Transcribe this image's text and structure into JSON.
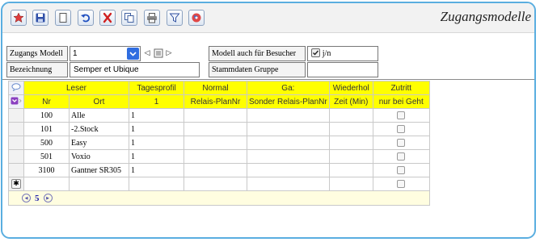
{
  "title": "Zugangsmodelle",
  "toolbar": {
    "buttons": [
      {
        "name": "home-button",
        "icon": "star-icon"
      },
      {
        "name": "save-button",
        "icon": "floppy-disk-icon"
      },
      {
        "name": "new-button",
        "icon": "document-icon"
      },
      {
        "name": "undo-button",
        "icon": "undo-icon"
      },
      {
        "name": "delete-button",
        "icon": "delete-x-icon"
      },
      {
        "name": "copy-button",
        "icon": "copy-icon"
      },
      {
        "name": "print-button",
        "icon": "printer-icon"
      },
      {
        "name": "filter-button",
        "icon": "funnel-icon"
      },
      {
        "name": "help-button",
        "icon": "help-icon"
      }
    ]
  },
  "form": {
    "zugangs_modell_label": "Zugangs Modell",
    "zugangs_modell_value": "1",
    "bezeichnung_label": "Bezeichnung",
    "bezeichnung_value": "Semper et Ubique",
    "modell_besucher_label": "Modell auch für Besucher",
    "modell_besucher_checked": true,
    "modell_besucher_option": "j/n",
    "stammdaten_label": "Stammdaten Gruppe",
    "stammdaten_value": ""
  },
  "grid": {
    "header_top": [
      "Leser",
      "Tagesprofil",
      "Normal",
      "Ga:",
      "Wiederhol",
      "Zutritt"
    ],
    "header_bottom": [
      "Nr",
      "Ort",
      "1",
      "Relais-PlanNr",
      "Sonder Relais-PlanNr",
      "Zeit (Min)",
      "nur bei Geht"
    ],
    "rows": [
      {
        "nr": "100",
        "ort": "Alle",
        "tagesprofil": "1"
      },
      {
        "nr": "101",
        "ort": "-2.Stock",
        "tagesprofil": "1"
      },
      {
        "nr": "500",
        "ort": "Easy",
        "tagesprofil": "1"
      },
      {
        "nr": "501",
        "ort": "Voxio",
        "tagesprofil": "1"
      },
      {
        "nr": "3100",
        "ort": "Gantner SR305",
        "tagesprofil": "1"
      }
    ],
    "page_number": "5"
  },
  "colors": {
    "header_yellow": "#ffff00",
    "frame_blue": "#5aaee0",
    "dropdown_blue": "#2f6de0"
  }
}
